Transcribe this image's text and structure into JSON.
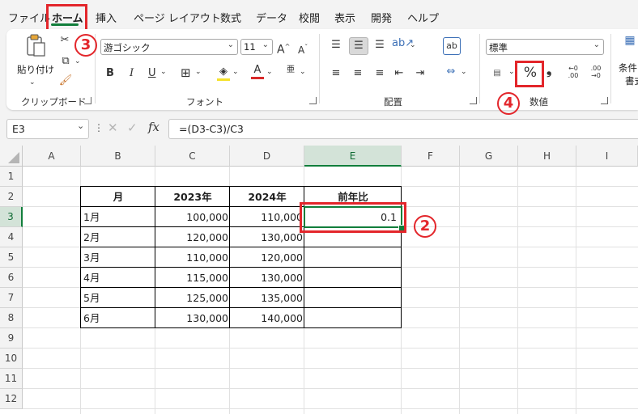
{
  "menu": {
    "tabs": [
      "ファイル",
      "ホーム",
      "挿入",
      "ページ レイアウト",
      "数式",
      "データ",
      "校閲",
      "表示",
      "開発",
      "ヘルプ"
    ]
  },
  "ribbon": {
    "clipboard": {
      "paste_label": "貼り付け",
      "group_label": "クリップボード"
    },
    "font": {
      "font_name": "游ゴシック",
      "font_size": "11",
      "group_label": "フォント",
      "bold": "B",
      "italic": "I",
      "underline": "U",
      "grow": "A",
      "shrink": "A",
      "phonetic": "亜"
    },
    "alignment": {
      "group_label": "配置"
    },
    "number": {
      "format": "標準",
      "percent": "%",
      "comma": "9",
      "group_label": "数値",
      "inc_decimal": "←0 .00",
      "dec_decimal": ".00 →0"
    },
    "styles": {
      "cond_format_line1": "条件",
      "cond_format_line2": "書式"
    }
  },
  "formula_bar": {
    "name_box": "E3",
    "fx": "fx",
    "formula": "=(D3-C3)/C3"
  },
  "sheet": {
    "columns": [
      "A",
      "B",
      "C",
      "D",
      "E",
      "F",
      "G",
      "H",
      "I"
    ],
    "rows": [
      "1",
      "2",
      "3",
      "4",
      "5",
      "6",
      "7",
      "8",
      "9",
      "10",
      "11",
      "12"
    ],
    "table": {
      "headers": [
        "月",
        "2023年",
        "2024年",
        "前年比"
      ],
      "rows": [
        [
          "1月",
          "100,000",
          "110,000",
          "0.1"
        ],
        [
          "2月",
          "120,000",
          "130,000",
          ""
        ],
        [
          "3月",
          "110,000",
          "120,000",
          ""
        ],
        [
          "4月",
          "115,000",
          "130,000",
          ""
        ],
        [
          "5月",
          "125,000",
          "135,000",
          ""
        ],
        [
          "6月",
          "130,000",
          "140,000",
          ""
        ]
      ]
    }
  },
  "annotations": {
    "step2": "2",
    "step3": "3",
    "step4": "4"
  },
  "colors": {
    "accent_green": "#117e3b",
    "annotation_red": "#e3262b"
  }
}
